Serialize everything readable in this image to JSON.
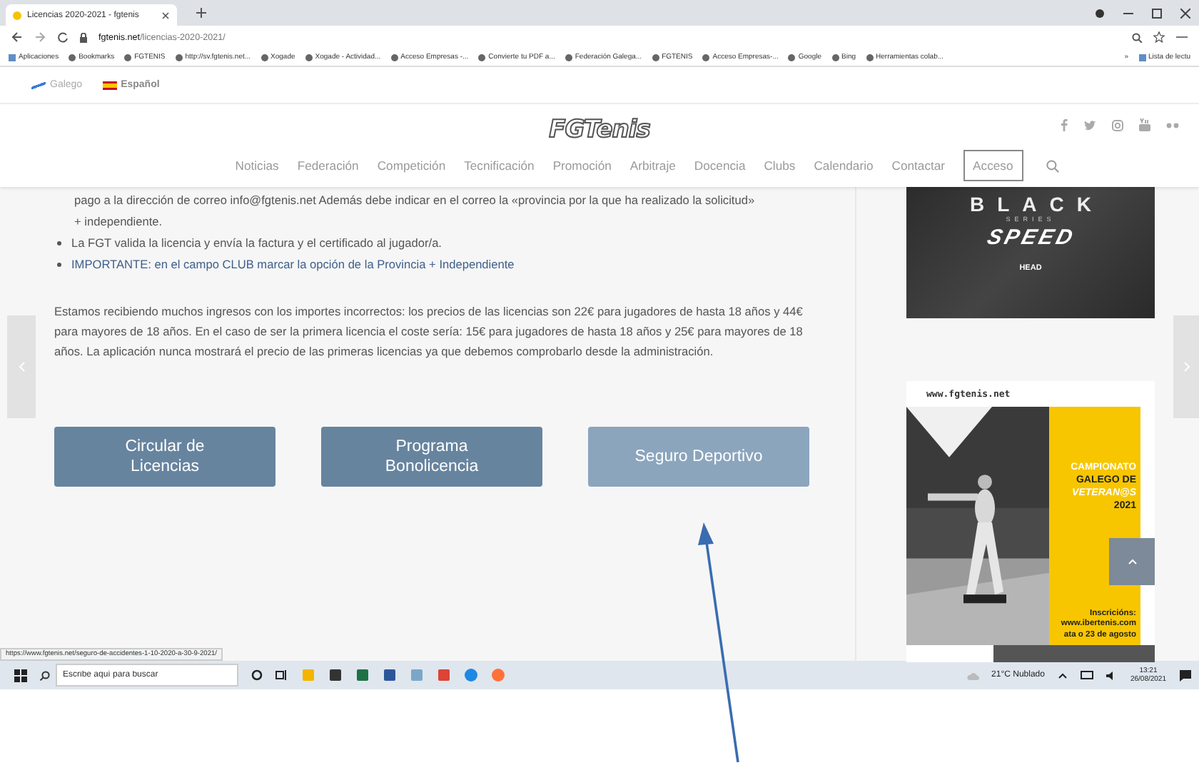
{
  "browser": {
    "tab_title": "Licencias 2020-2021 - fgtenis",
    "url_host": "fgtenis.net",
    "url_path": "/licencias-2020-2021/",
    "bookmarks": [
      "Aplicaciones",
      "Bookmarks",
      "FGTENIS",
      "http://sv.fgtenis.net...",
      "Xogade",
      "Xogade - Actividad...",
      "Acceso Empresas -...",
      "Convierte tu PDF a...",
      "Federación Galega...",
      "FGTENIS",
      "Acceso Empresas-...",
      "Google",
      "Bing",
      "Herramientas colab..."
    ],
    "more": "»",
    "reading_list": "Lista de lectu",
    "status_url": "https://www.fgtenis.net/seguro-de-accidentes-1-10-2020-a-30-9-2021/"
  },
  "site": {
    "languages": [
      {
        "label": "Galego",
        "selected": false
      },
      {
        "label": "Español",
        "selected": true
      }
    ],
    "logo": "FGTenis",
    "nav": [
      "Noticias",
      "Federación",
      "Competición",
      "Tecnificación",
      "Promoción",
      "Arbitraje",
      "Docencia",
      "Clubs",
      "Calendario",
      "Contactar"
    ],
    "login": "Acceso"
  },
  "content": {
    "list": [
      {
        "kind": "continuation",
        "text": "pago a la dirección de correo info@fgtenis.net Además debe indicar en el correo la «provincia por la que ha realizado la solicitud»"
      },
      {
        "kind": "continuation",
        "text": "+ independiente."
      },
      {
        "kind": "bullet",
        "text": "La FGT valida la licencia y envía la factura y el certificado al jugador/a."
      },
      {
        "kind": "highlight",
        "text": "IMPORTANTE: en el campo CLUB marcar la opción de la Provincia + Independiente"
      }
    ],
    "paragraph": "Estamos recibiendo muchos ingresos con los importes incorrectos: los precios de las licencias son 22€ para jugadores de hasta 18 años y 44€ para mayores de 18 años. En el caso de ser la primera licencia el coste sería: 15€ para jugadores de hasta 18 años y 25€ para mayores de 18 años. La aplicación nunca mostrará el precio de las primeras licencias ya que debemos comprobarlo desde la administración.",
    "buttons": [
      {
        "label": "Circular de Licencias",
        "hovered": false
      },
      {
        "label": "Programa Bonolicencia",
        "hovered": false
      },
      {
        "label": "Seguro Deportivo",
        "hovered": true
      }
    ]
  },
  "ads": [
    {
      "kind": "racket",
      "title": "BLACK",
      "subtitle": "SERIES",
      "model": "SPEED",
      "brand": "HEAD"
    },
    {
      "kind": "tournament",
      "site": "www.fgtenis.net",
      "lines": [
        "CAMPIONATO",
        "GALEGO DE",
        "VETERAN@S",
        "2021"
      ],
      "info": [
        "Inscricións:",
        "www.ibertenis.com",
        "ata o 23 de agosto"
      ]
    }
  ],
  "taskbar": {
    "search_placeholder": "Escribe aquí para buscar",
    "weather": "21°C Nublado",
    "time": "13:21",
    "date": "26/08/2021"
  }
}
